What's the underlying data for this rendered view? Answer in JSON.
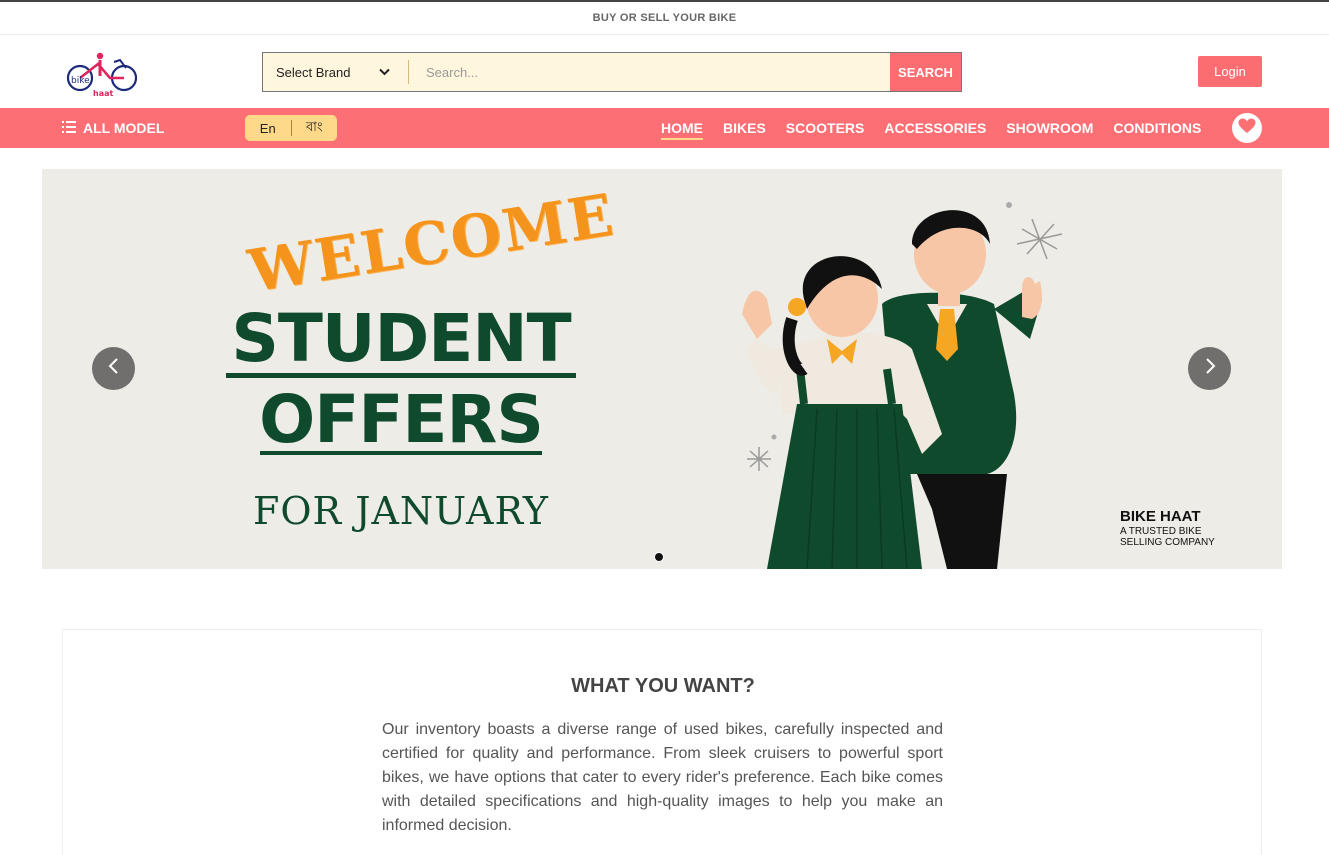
{
  "topbar": {
    "text": "BUY OR SELL YOUR BIKE"
  },
  "header": {
    "logo_text_bike": "bike",
    "logo_text_haat": "haat",
    "brand_select_value": "Select Brand",
    "search_placeholder": "Search...",
    "search_button": "SEARCH",
    "login_button": "Login"
  },
  "nav": {
    "all_model": "ALL MODEL",
    "lang_en": "En",
    "lang_bn": "বাং",
    "links": [
      "HOME",
      "BIKES",
      "SCOOTERS",
      "ACCESSORIES",
      "SHOWROOM",
      "CONDITIONS"
    ],
    "active": "HOME"
  },
  "banner": {
    "welcome": "WELCOME",
    "student": "STUDENT",
    "offers": "OFFERS",
    "for_january": "FOR JANUARY",
    "company_name": "BIKE HAAT",
    "company_tagline": "A TRUSTED BIKE SELLING COMPANY"
  },
  "info": {
    "title": "WHAT YOU WANT?",
    "text": "Our inventory boasts a diverse range of used bikes, carefully inspected and certified for quality and performance. From sleek cruisers to powerful sport bikes, we have options that cater to every rider's preference. Each bike comes with detailed specifications and high-quality images to help you make an informed decision."
  },
  "colors": {
    "accent": "#fc6f74",
    "lang_toggle": "#ffd98a",
    "banner_green": "#0f4a2d",
    "banner_orange": "#f5941c"
  }
}
